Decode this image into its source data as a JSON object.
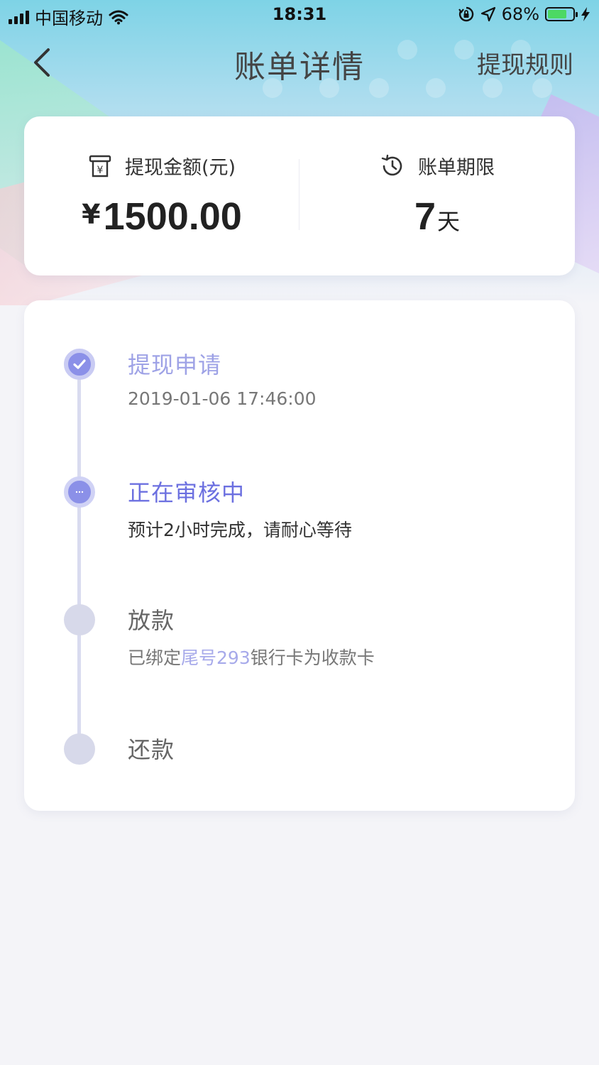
{
  "status_bar": {
    "carrier": "中国移动",
    "time": "18:31",
    "battery_percent": "68%",
    "battery_level": 0.68
  },
  "nav": {
    "title": "账单详情",
    "right_action": "提现规则"
  },
  "summary": {
    "amount_label": "提现金额(元)",
    "amount_currency": "¥",
    "amount_value": "1500.00",
    "term_label": "账单期限",
    "term_value": "7",
    "term_unit": "天"
  },
  "progress": {
    "steps": [
      {
        "title": "提现申请",
        "subtitle": "2019-01-06 17:46:00",
        "state": "done"
      },
      {
        "title": "正在审核中",
        "subtitle": "预计2小时完成，请耐心等待",
        "state": "active"
      },
      {
        "title": "放款",
        "subtitle_prefix": "已绑定",
        "subtitle_highlight": "尾号293",
        "subtitle_suffix": "银行卡为收款卡",
        "state": "pending"
      },
      {
        "title": "还款",
        "state": "pending"
      }
    ]
  },
  "colors": {
    "accent": "#6c70e0",
    "accent_light": "#9ea2e6",
    "pending_dot": "#d7d9ea",
    "card_bg": "#ffffff",
    "page_bg": "#f4f4f8"
  }
}
